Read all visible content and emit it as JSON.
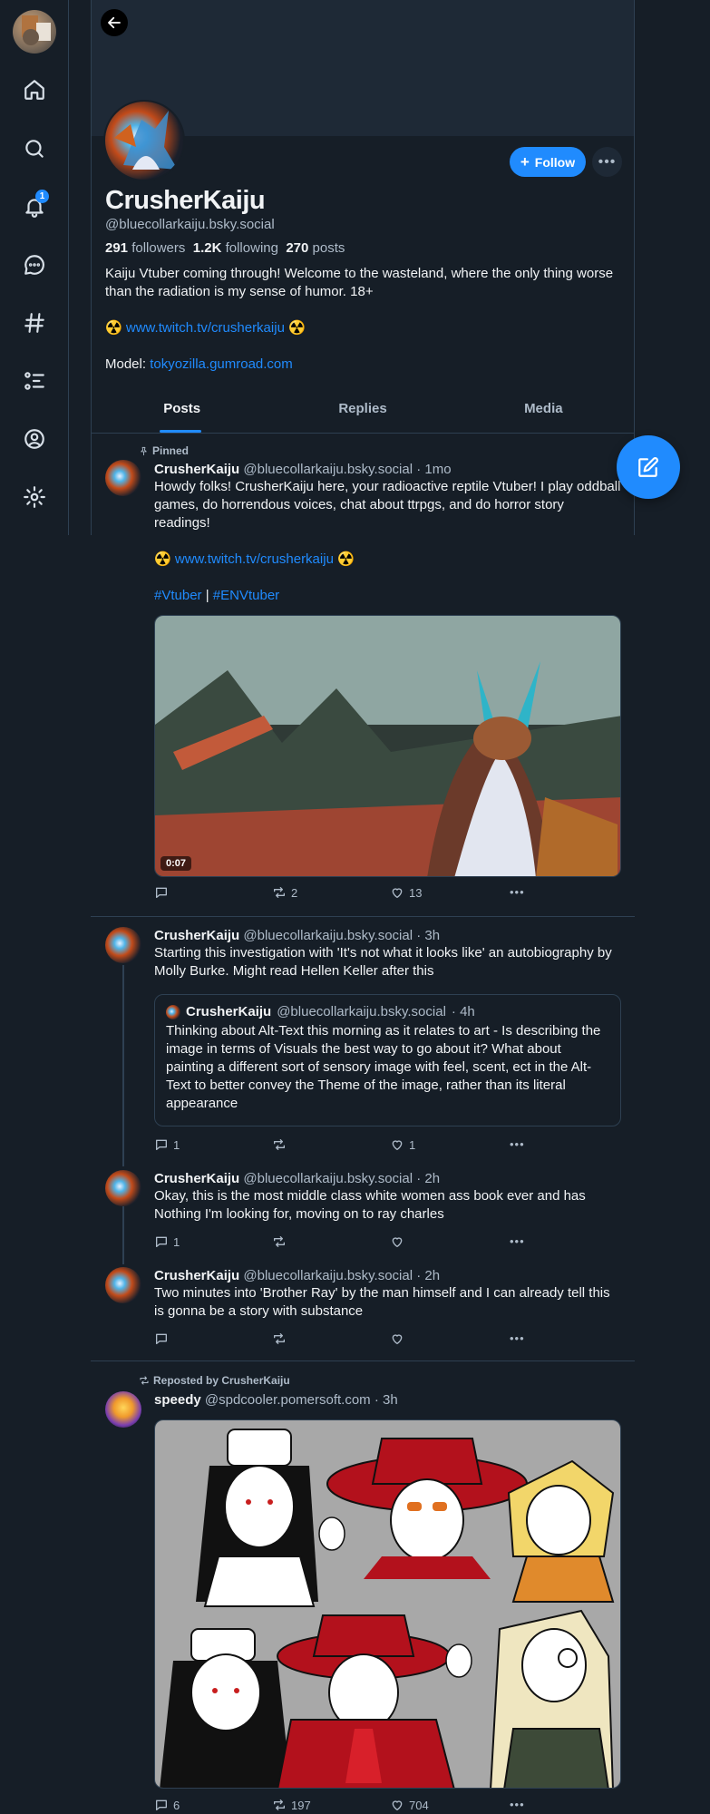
{
  "nav": {
    "notification_count": "1",
    "items": [
      "home",
      "search",
      "notifications",
      "chat",
      "feeds",
      "lists",
      "profile",
      "settings"
    ]
  },
  "profile": {
    "display_name": "CrusherKaiju",
    "handle": "@bluecollarkaiju.bsky.social",
    "followers_count": "291",
    "followers_label": "followers",
    "following_count": "1.2K",
    "following_label": "following",
    "posts_count": "270",
    "posts_label": "posts",
    "follow_label": "Follow",
    "bio_line1": "Kaiju Vtuber coming through! Welcome to the wasteland, where the only thing worse than the radiation is my sense of humor. 18+",
    "bio_link_prefix": "☢️ ",
    "bio_link": "www.twitch.tv/crusherkaiju",
    "bio_link_suffix": " ☢️",
    "bio_model_label": "Model: ",
    "bio_model_link": "tokyozilla.gumroad.com"
  },
  "tabs": [
    "Posts",
    "Replies",
    "Media"
  ],
  "posts": [
    {
      "pinned_label": "Pinned",
      "name": "CrusherKaiju",
      "handle": "@bluecollarkaiju.bsky.social",
      "time": "· 1mo",
      "text": "Howdy folks! CrusherKaiju here, your radioactive reptile Vtuber! I play oddball games, do horrendous voices, chat about ttrpgs, and do horror story readings!",
      "link_prefix": "☢️ ",
      "link": "www.twitch.tv/crusherkaiju",
      "link_suffix": " ☢️",
      "tag1": "#Vtuber",
      "tag_sep": " | ",
      "tag2": "#ENVtuber",
      "video_duration": "0:07",
      "replies": "",
      "reposts": "2",
      "likes": "13"
    },
    {
      "name": "CrusherKaiju",
      "handle": "@bluecollarkaiju.bsky.social",
      "time": "· 3h",
      "text": "Starting this investigation with 'It's not what it looks like' an autobiography by Molly Burke. Might read Hellen Keller after this",
      "quote_name": "CrusherKaiju",
      "quote_handle": "@bluecollarkaiju.bsky.social",
      "quote_time": "· 4h",
      "quote_text": "Thinking about Alt-Text this morning as it relates to art - Is describing the image in terms of Visuals the best way to go about it? What about painting a different sort of sensory image with feel, scent, ect in the Alt-Text to better convey the Theme of the image, rather than its literal appearance",
      "replies": "1",
      "reposts": "",
      "likes": "1"
    },
    {
      "name": "CrusherKaiju",
      "handle": "@bluecollarkaiju.bsky.social",
      "time": "· 2h",
      "text": "Okay, this is the most middle class white women ass book ever and has Nothing I'm looking for, moving on to ray charles",
      "replies": "1",
      "reposts": "",
      "likes": ""
    },
    {
      "name": "CrusherKaiju",
      "handle": "@bluecollarkaiju.bsky.social",
      "time": "· 2h",
      "text": "Two minutes into 'Brother Ray' by the man himself and I can already tell this is gonna be a story with substance",
      "replies": "",
      "reposts": "",
      "likes": ""
    },
    {
      "repost_label": "Reposted by CrusherKaiju",
      "name": "speedy",
      "handle": "@spdcooler.pomersoft.com",
      "time": "· 3h",
      "replies": "6",
      "reposts": "197",
      "likes": "704"
    }
  ],
  "colors": {
    "background": "#161e27",
    "accent": "#208bfe",
    "border": "#2e4052",
    "muted_text": "#aebbc9"
  }
}
